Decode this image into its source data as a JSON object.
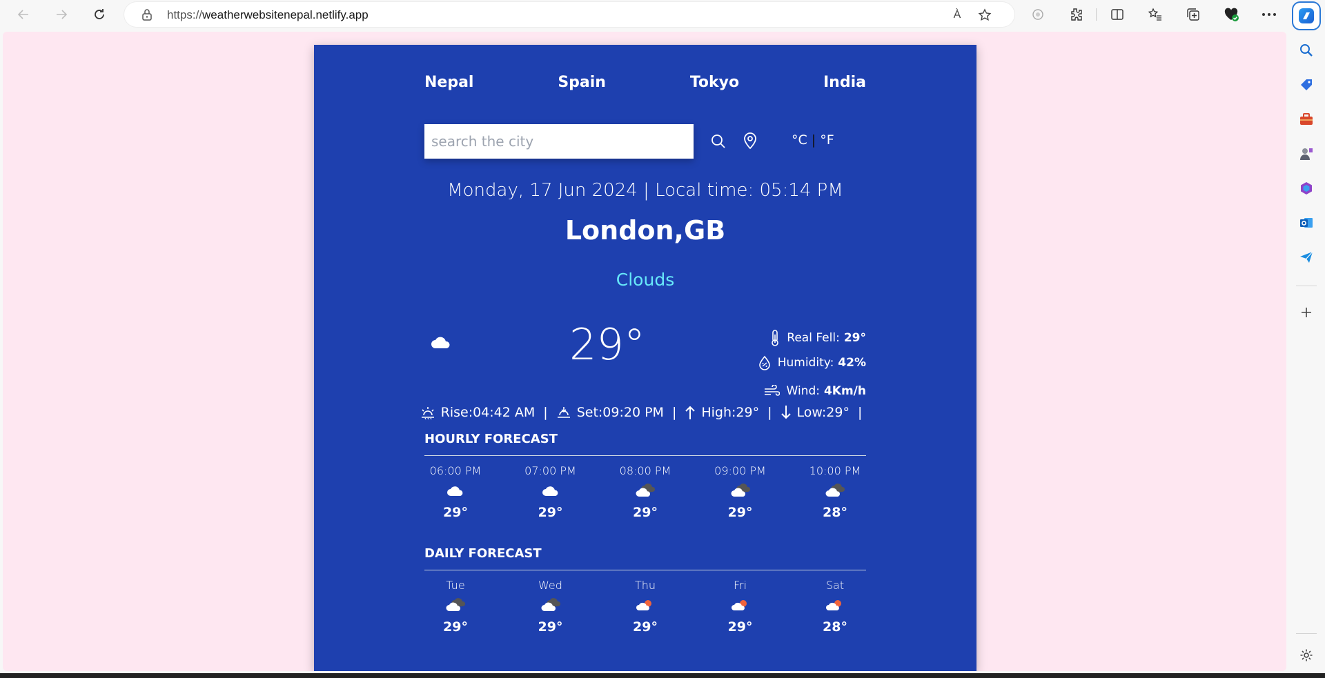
{
  "browser": {
    "url_prefix": "https://",
    "url_host": "weatherwebsitenepal.netlify.app",
    "read_aloud_label": "À"
  },
  "app": {
    "cities": [
      "Nepal",
      "Spain",
      "Tokyo",
      "India"
    ],
    "search_placeholder": "search the city",
    "unit_celsius": "°C",
    "unit_separator": "|",
    "unit_fahrenheit": "°F",
    "datetime": "Monday, 17 Jun 2024 | Local time: 05:14 PM",
    "location": "London,GB",
    "condition": "Clouds",
    "temperature": "29°",
    "details": {
      "real_feel_label": "Real Fell:",
      "real_feel_value": "29°",
      "humidity_label": "Humidity:",
      "humidity_value": "42%",
      "wind_label": "Wind:",
      "wind_value": "4Km/h"
    },
    "sun": {
      "rise": "Rise:04:42 AM",
      "set": "Set:09:20 PM",
      "high": "High:29°",
      "low": "Low:29°",
      "separator": "|"
    },
    "hourly_title": "HOURLY FORECAST",
    "hourly": [
      {
        "label": "06:00 PM",
        "temp": "29°",
        "icon": "cloud-icon"
      },
      {
        "label": "07:00 PM",
        "temp": "29°",
        "icon": "cloud-icon"
      },
      {
        "label": "08:00 PM",
        "temp": "29°",
        "icon": "broken-clouds-icon"
      },
      {
        "label": "09:00 PM",
        "temp": "29°",
        "icon": "broken-clouds-icon"
      },
      {
        "label": "10:00 PM",
        "temp": "28°",
        "icon": "broken-clouds-icon"
      }
    ],
    "daily_title": "DAILY FORECAST",
    "daily": [
      {
        "label": "Tue",
        "temp": "29°",
        "icon": "broken-clouds-icon"
      },
      {
        "label": "Wed",
        "temp": "29°",
        "icon": "broken-clouds-icon"
      },
      {
        "label": "Thu",
        "temp": "29°",
        "icon": "few-clouds-sun-icon"
      },
      {
        "label": "Fri",
        "temp": "29°",
        "icon": "few-clouds-sun-icon"
      },
      {
        "label": "Sat",
        "temp": "28°",
        "icon": "few-clouds-sun-icon"
      }
    ]
  },
  "colors": {
    "card_bg": "#1e40af",
    "page_bg": "#fee7f1",
    "condition_text": "#67e8f9"
  }
}
